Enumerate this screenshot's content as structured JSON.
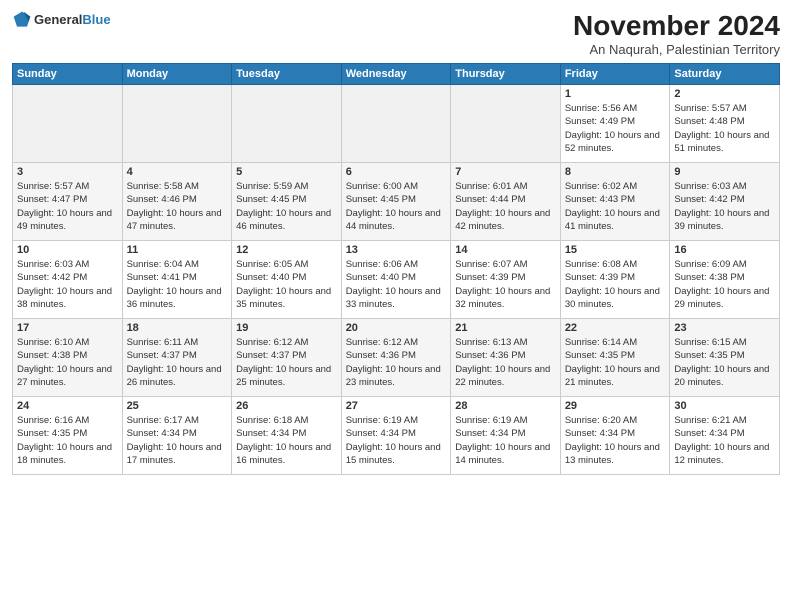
{
  "logo": {
    "general": "General",
    "blue": "Blue"
  },
  "title": "November 2024",
  "subtitle": "An Naqurah, Palestinian Territory",
  "days": [
    "Sunday",
    "Monday",
    "Tuesday",
    "Wednesday",
    "Thursday",
    "Friday",
    "Saturday"
  ],
  "weeks": [
    [
      {
        "day": "",
        "empty": true
      },
      {
        "day": "",
        "empty": true
      },
      {
        "day": "",
        "empty": true
      },
      {
        "day": "",
        "empty": true
      },
      {
        "day": "",
        "empty": true
      },
      {
        "day": "1",
        "sunrise": "Sunrise: 5:56 AM",
        "sunset": "Sunset: 4:49 PM",
        "daylight": "Daylight: 10 hours and 52 minutes."
      },
      {
        "day": "2",
        "sunrise": "Sunrise: 5:57 AM",
        "sunset": "Sunset: 4:48 PM",
        "daylight": "Daylight: 10 hours and 51 minutes."
      }
    ],
    [
      {
        "day": "3",
        "sunrise": "Sunrise: 5:57 AM",
        "sunset": "Sunset: 4:47 PM",
        "daylight": "Daylight: 10 hours and 49 minutes."
      },
      {
        "day": "4",
        "sunrise": "Sunrise: 5:58 AM",
        "sunset": "Sunset: 4:46 PM",
        "daylight": "Daylight: 10 hours and 47 minutes."
      },
      {
        "day": "5",
        "sunrise": "Sunrise: 5:59 AM",
        "sunset": "Sunset: 4:45 PM",
        "daylight": "Daylight: 10 hours and 46 minutes."
      },
      {
        "day": "6",
        "sunrise": "Sunrise: 6:00 AM",
        "sunset": "Sunset: 4:45 PM",
        "daylight": "Daylight: 10 hours and 44 minutes."
      },
      {
        "day": "7",
        "sunrise": "Sunrise: 6:01 AM",
        "sunset": "Sunset: 4:44 PM",
        "daylight": "Daylight: 10 hours and 42 minutes."
      },
      {
        "day": "8",
        "sunrise": "Sunrise: 6:02 AM",
        "sunset": "Sunset: 4:43 PM",
        "daylight": "Daylight: 10 hours and 41 minutes."
      },
      {
        "day": "9",
        "sunrise": "Sunrise: 6:03 AM",
        "sunset": "Sunset: 4:42 PM",
        "daylight": "Daylight: 10 hours and 39 minutes."
      }
    ],
    [
      {
        "day": "10",
        "sunrise": "Sunrise: 6:03 AM",
        "sunset": "Sunset: 4:42 PM",
        "daylight": "Daylight: 10 hours and 38 minutes."
      },
      {
        "day": "11",
        "sunrise": "Sunrise: 6:04 AM",
        "sunset": "Sunset: 4:41 PM",
        "daylight": "Daylight: 10 hours and 36 minutes."
      },
      {
        "day": "12",
        "sunrise": "Sunrise: 6:05 AM",
        "sunset": "Sunset: 4:40 PM",
        "daylight": "Daylight: 10 hours and 35 minutes."
      },
      {
        "day": "13",
        "sunrise": "Sunrise: 6:06 AM",
        "sunset": "Sunset: 4:40 PM",
        "daylight": "Daylight: 10 hours and 33 minutes."
      },
      {
        "day": "14",
        "sunrise": "Sunrise: 6:07 AM",
        "sunset": "Sunset: 4:39 PM",
        "daylight": "Daylight: 10 hours and 32 minutes."
      },
      {
        "day": "15",
        "sunrise": "Sunrise: 6:08 AM",
        "sunset": "Sunset: 4:39 PM",
        "daylight": "Daylight: 10 hours and 30 minutes."
      },
      {
        "day": "16",
        "sunrise": "Sunrise: 6:09 AM",
        "sunset": "Sunset: 4:38 PM",
        "daylight": "Daylight: 10 hours and 29 minutes."
      }
    ],
    [
      {
        "day": "17",
        "sunrise": "Sunrise: 6:10 AM",
        "sunset": "Sunset: 4:38 PM",
        "daylight": "Daylight: 10 hours and 27 minutes."
      },
      {
        "day": "18",
        "sunrise": "Sunrise: 6:11 AM",
        "sunset": "Sunset: 4:37 PM",
        "daylight": "Daylight: 10 hours and 26 minutes."
      },
      {
        "day": "19",
        "sunrise": "Sunrise: 6:12 AM",
        "sunset": "Sunset: 4:37 PM",
        "daylight": "Daylight: 10 hours and 25 minutes."
      },
      {
        "day": "20",
        "sunrise": "Sunrise: 6:12 AM",
        "sunset": "Sunset: 4:36 PM",
        "daylight": "Daylight: 10 hours and 23 minutes."
      },
      {
        "day": "21",
        "sunrise": "Sunrise: 6:13 AM",
        "sunset": "Sunset: 4:36 PM",
        "daylight": "Daylight: 10 hours and 22 minutes."
      },
      {
        "day": "22",
        "sunrise": "Sunrise: 6:14 AM",
        "sunset": "Sunset: 4:35 PM",
        "daylight": "Daylight: 10 hours and 21 minutes."
      },
      {
        "day": "23",
        "sunrise": "Sunrise: 6:15 AM",
        "sunset": "Sunset: 4:35 PM",
        "daylight": "Daylight: 10 hours and 20 minutes."
      }
    ],
    [
      {
        "day": "24",
        "sunrise": "Sunrise: 6:16 AM",
        "sunset": "Sunset: 4:35 PM",
        "daylight": "Daylight: 10 hours and 18 minutes."
      },
      {
        "day": "25",
        "sunrise": "Sunrise: 6:17 AM",
        "sunset": "Sunset: 4:34 PM",
        "daylight": "Daylight: 10 hours and 17 minutes."
      },
      {
        "day": "26",
        "sunrise": "Sunrise: 6:18 AM",
        "sunset": "Sunset: 4:34 PM",
        "daylight": "Daylight: 10 hours and 16 minutes."
      },
      {
        "day": "27",
        "sunrise": "Sunrise: 6:19 AM",
        "sunset": "Sunset: 4:34 PM",
        "daylight": "Daylight: 10 hours and 15 minutes."
      },
      {
        "day": "28",
        "sunrise": "Sunrise: 6:19 AM",
        "sunset": "Sunset: 4:34 PM",
        "daylight": "Daylight: 10 hours and 14 minutes."
      },
      {
        "day": "29",
        "sunrise": "Sunrise: 6:20 AM",
        "sunset": "Sunset: 4:34 PM",
        "daylight": "Daylight: 10 hours and 13 minutes."
      },
      {
        "day": "30",
        "sunrise": "Sunrise: 6:21 AM",
        "sunset": "Sunset: 4:34 PM",
        "daylight": "Daylight: 10 hours and 12 minutes."
      }
    ]
  ]
}
